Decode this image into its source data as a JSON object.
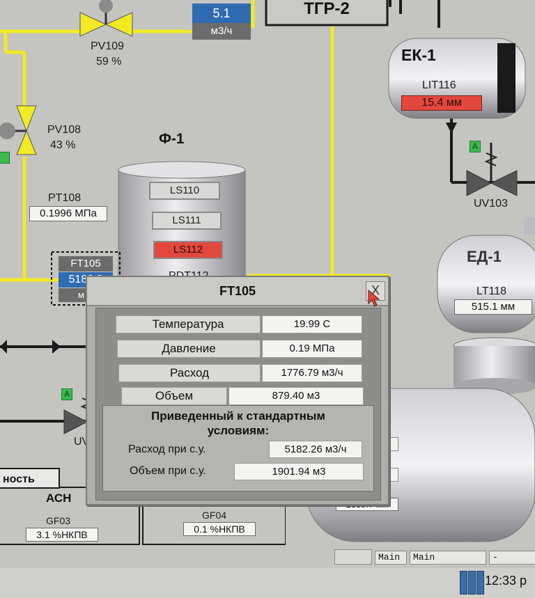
{
  "colors": {
    "background": "#c4c4c1",
    "pipe_yellow": "#f2ea23",
    "pipe_black": "#1b1b1b",
    "alarm_red": "#e2483e",
    "value_blue": "#2f6bb1",
    "auto_green": "#3bbb4c"
  },
  "mnemonic": {
    "tgr2": "ТГР-2",
    "flow_5_1": {
      "value": "5.1",
      "unit": "м3/ч"
    },
    "pv109": {
      "tag": "PV109",
      "value": "59 %"
    },
    "pv108": {
      "tag": "PV108",
      "value": "43 %"
    },
    "pt108": {
      "tag": "PT108",
      "value": "0.1996 МПа"
    },
    "f1": {
      "title": "Ф-1",
      "levels": [
        "LS110",
        "LS111",
        "LS112"
      ],
      "pdt": "PDT112"
    },
    "ft105": {
      "tag": "FT105",
      "value": "5182.3",
      "unit": "м"
    },
    "ek1": {
      "title": "ЕК-1",
      "tag": "LIT116",
      "value": "15.4 мм"
    },
    "uv103": {
      "tag": "UV103",
      "mode": "A"
    },
    "ed1": {
      "title": "ЕД-1",
      "tag": "LT118",
      "value": "515.1 мм"
    },
    "uv10x": {
      "tag": "UV10",
      "mode": "A"
    },
    "lower_vessel_value": "1339.7 мм",
    "btn_partial": "ность",
    "ach": "АСН",
    "gf03": {
      "tag": "GF03",
      "value": "3.1 %НКПВ"
    },
    "gf04": {
      "tag": "GF04",
      "value": "0.1 %НКПВ"
    }
  },
  "dialog": {
    "title": "FT105",
    "close_label": "X",
    "rows": [
      {
        "label": "Температура",
        "value": "19.99 С"
      },
      {
        "label": "Давление",
        "value": "0.19 МПа"
      },
      {
        "label": "Расход",
        "value": "1776.79 м3/ч"
      },
      {
        "label": "Объем",
        "value": "879.40 м3"
      }
    ],
    "std_heading_1": "Приведенный к стандартным",
    "std_heading_2": "условиям:",
    "std_rows": [
      {
        "label": "Расход при с.у.",
        "value": "5182.26 м3/ч"
      },
      {
        "label": "Объем при с.у.",
        "value": "1901.94 м3"
      }
    ]
  },
  "taskbar": {
    "items": [
      "Main",
      "Main",
      "-"
    ],
    "clock": "12:33 р"
  }
}
